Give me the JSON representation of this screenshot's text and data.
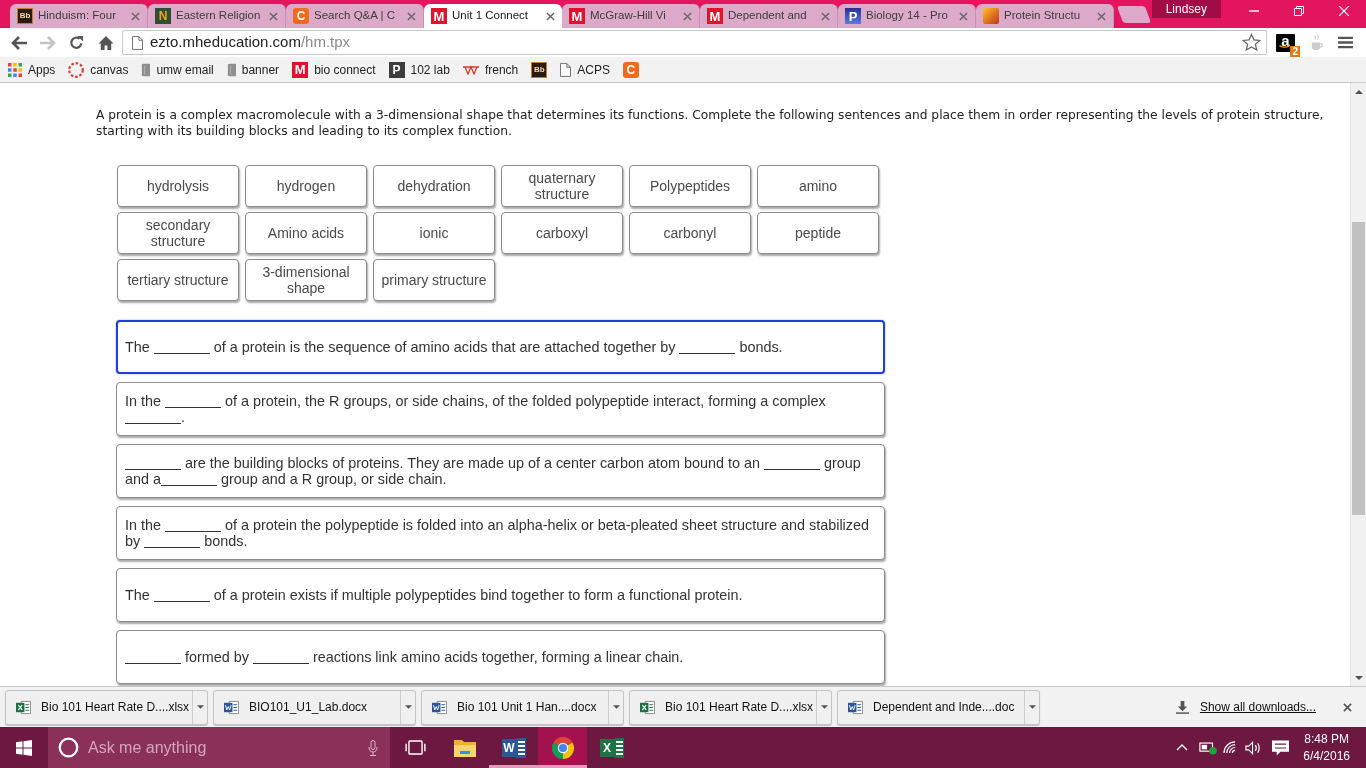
{
  "browser": {
    "tabs": [
      {
        "title": "Hinduism: Four",
        "selected": false,
        "favicon": {
          "kind": "dark",
          "text": "Bb"
        }
      },
      {
        "title": "Eastern Religion",
        "selected": false,
        "favicon": {
          "kind": "green",
          "text": "N"
        }
      },
      {
        "title": "Search Q&A | C",
        "selected": false,
        "favicon": {
          "kind": "orange",
          "text": "C"
        }
      },
      {
        "title": "Unit 1 Connect",
        "selected": true,
        "favicon": {
          "kind": "red",
          "text": "M"
        }
      },
      {
        "title": "McGraw-Hill Vi",
        "selected": false,
        "favicon": {
          "kind": "red",
          "text": "M"
        }
      },
      {
        "title": "Dependent and",
        "selected": false,
        "favicon": {
          "kind": "red",
          "text": "M"
        }
      },
      {
        "title": "Biology 14 - Pro",
        "selected": false,
        "favicon": {
          "kind": "blue",
          "text": "P"
        }
      },
      {
        "title": "Protein Structu",
        "selected": false,
        "favicon": {
          "kind": "photo"
        }
      }
    ],
    "profile": "Lindsey",
    "navigation": [
      {
        "kind": "back",
        "disabled": false
      },
      {
        "kind": "forward",
        "disabled": true
      },
      {
        "kind": "reload",
        "disabled": false
      },
      {
        "kind": "home",
        "disabled": false
      }
    ],
    "address": {
      "host": "ezto.mheducation.com",
      "path": "/hm.tpx"
    },
    "extensions": [
      {
        "kind": "amazon",
        "text": "a",
        "badge": "2"
      },
      {
        "kind": "java"
      }
    ],
    "bookmarks": [
      {
        "label": "Apps",
        "icon": {
          "kind": "apps"
        }
      },
      {
        "label": "canvas",
        "icon": {
          "kind": "ring"
        }
      },
      {
        "label": "umw email",
        "icon": {
          "kind": "scroll"
        }
      },
      {
        "label": "banner",
        "icon": {
          "kind": "scroll"
        }
      },
      {
        "label": "bio connect",
        "icon": {
          "kind": "red",
          "text": "M"
        }
      },
      {
        "label": "102 lab",
        "icon": {
          "kind": "slate",
          "text": "P"
        }
      },
      {
        "label": "french",
        "icon": {
          "kind": "zigzag"
        }
      },
      {
        "icon": {
          "kind": "dark",
          "text": "Bb"
        }
      },
      {
        "label": "ACPS",
        "icon": {
          "kind": "page"
        }
      },
      {
        "icon": {
          "kind": "orange",
          "text": "C"
        }
      }
    ]
  },
  "question": {
    "prompt": "A protein is a complex macromolecule with a 3-dimensional shape that determines its functions. Complete the following sentences and place them in order representing the levels of protein structure, starting with its building blocks and leading to its complex function.",
    "choices": [
      "hydrolysis",
      "hydrogen",
      "dehydration",
      "quaternary structure",
      "Polypeptides",
      "amino",
      "secondary structure",
      "Amino acids",
      "ionic",
      "carboxyl",
      "carbonyl",
      "peptide",
      "tertiary structure",
      "3-dimensional shape",
      "primary structure"
    ],
    "sentences": [
      {
        "selected": true,
        "parts": [
          {
            "kind": "text",
            "text": "The "
          },
          {
            "kind": "blank"
          },
          {
            "kind": "text",
            "text": " of a protein is the sequence of amino acids that are attached together by "
          },
          {
            "kind": "blank"
          },
          {
            "kind": "text",
            "text": " bonds."
          }
        ]
      },
      {
        "selected": false,
        "parts": [
          {
            "kind": "text",
            "text": "In the "
          },
          {
            "kind": "blank"
          },
          {
            "kind": "text",
            "text": " of a protein, the R groups, or side chains, of the folded polypeptide interact, forming a complex "
          },
          {
            "kind": "blank"
          },
          {
            "kind": "text",
            "text": "."
          }
        ]
      },
      {
        "selected": false,
        "parts": [
          {
            "kind": "blank"
          },
          {
            "kind": "text",
            "text": " are the building blocks of proteins. They are made up of a center carbon atom bound to an "
          },
          {
            "kind": "blank"
          },
          {
            "kind": "text",
            "text": " group and a"
          },
          {
            "kind": "blank"
          },
          {
            "kind": "text",
            "text": " group and a R group, or side chain."
          }
        ]
      },
      {
        "selected": false,
        "parts": [
          {
            "kind": "text",
            "text": "In the "
          },
          {
            "kind": "blank"
          },
          {
            "kind": "text",
            "text": " of a protein the polypeptide is folded into an alpha-helix or beta-pleated sheet structure and stabilized by "
          },
          {
            "kind": "blank"
          },
          {
            "kind": "text",
            "text": " bonds."
          }
        ]
      },
      {
        "selected": false,
        "parts": [
          {
            "kind": "text",
            "text": "The "
          },
          {
            "kind": "blank"
          },
          {
            "kind": "text",
            "text": " of a protein exists if multiple polypeptides bind together to form a functional protein."
          }
        ]
      },
      {
        "selected": false,
        "parts": [
          {
            "kind": "blank"
          },
          {
            "kind": "text",
            "text": " formed by "
          },
          {
            "kind": "blank"
          },
          {
            "kind": "text",
            "text": " reactions link amino acids together, forming a linear chain."
          }
        ]
      }
    ]
  },
  "downloads": {
    "items": [
      {
        "name": "Bio 101 Heart Rate D....xlsx",
        "kind": "excel"
      },
      {
        "name": "BIO101_U1_Lab.docx",
        "kind": "word"
      },
      {
        "name": "Bio 101 Unit 1 Han....docx",
        "kind": "word"
      },
      {
        "name": "Bio 101 Heart Rate D....xlsx",
        "kind": "excel"
      },
      {
        "name": "Dependent and Inde....doc",
        "kind": "word"
      }
    ],
    "show_all": "Show all downloads..."
  },
  "taskbar": {
    "search_placeholder": "Ask me anything",
    "apps": [
      {
        "kind": "explorer",
        "running": false,
        "selected": false
      },
      {
        "kind": "word",
        "letter": "W",
        "running": true,
        "selected": false
      },
      {
        "kind": "chrome",
        "running": true,
        "selected": true
      },
      {
        "kind": "excel",
        "letter": "X",
        "running": false,
        "selected": false
      }
    ],
    "time": "8:48 PM",
    "date": "6/4/2016"
  }
}
